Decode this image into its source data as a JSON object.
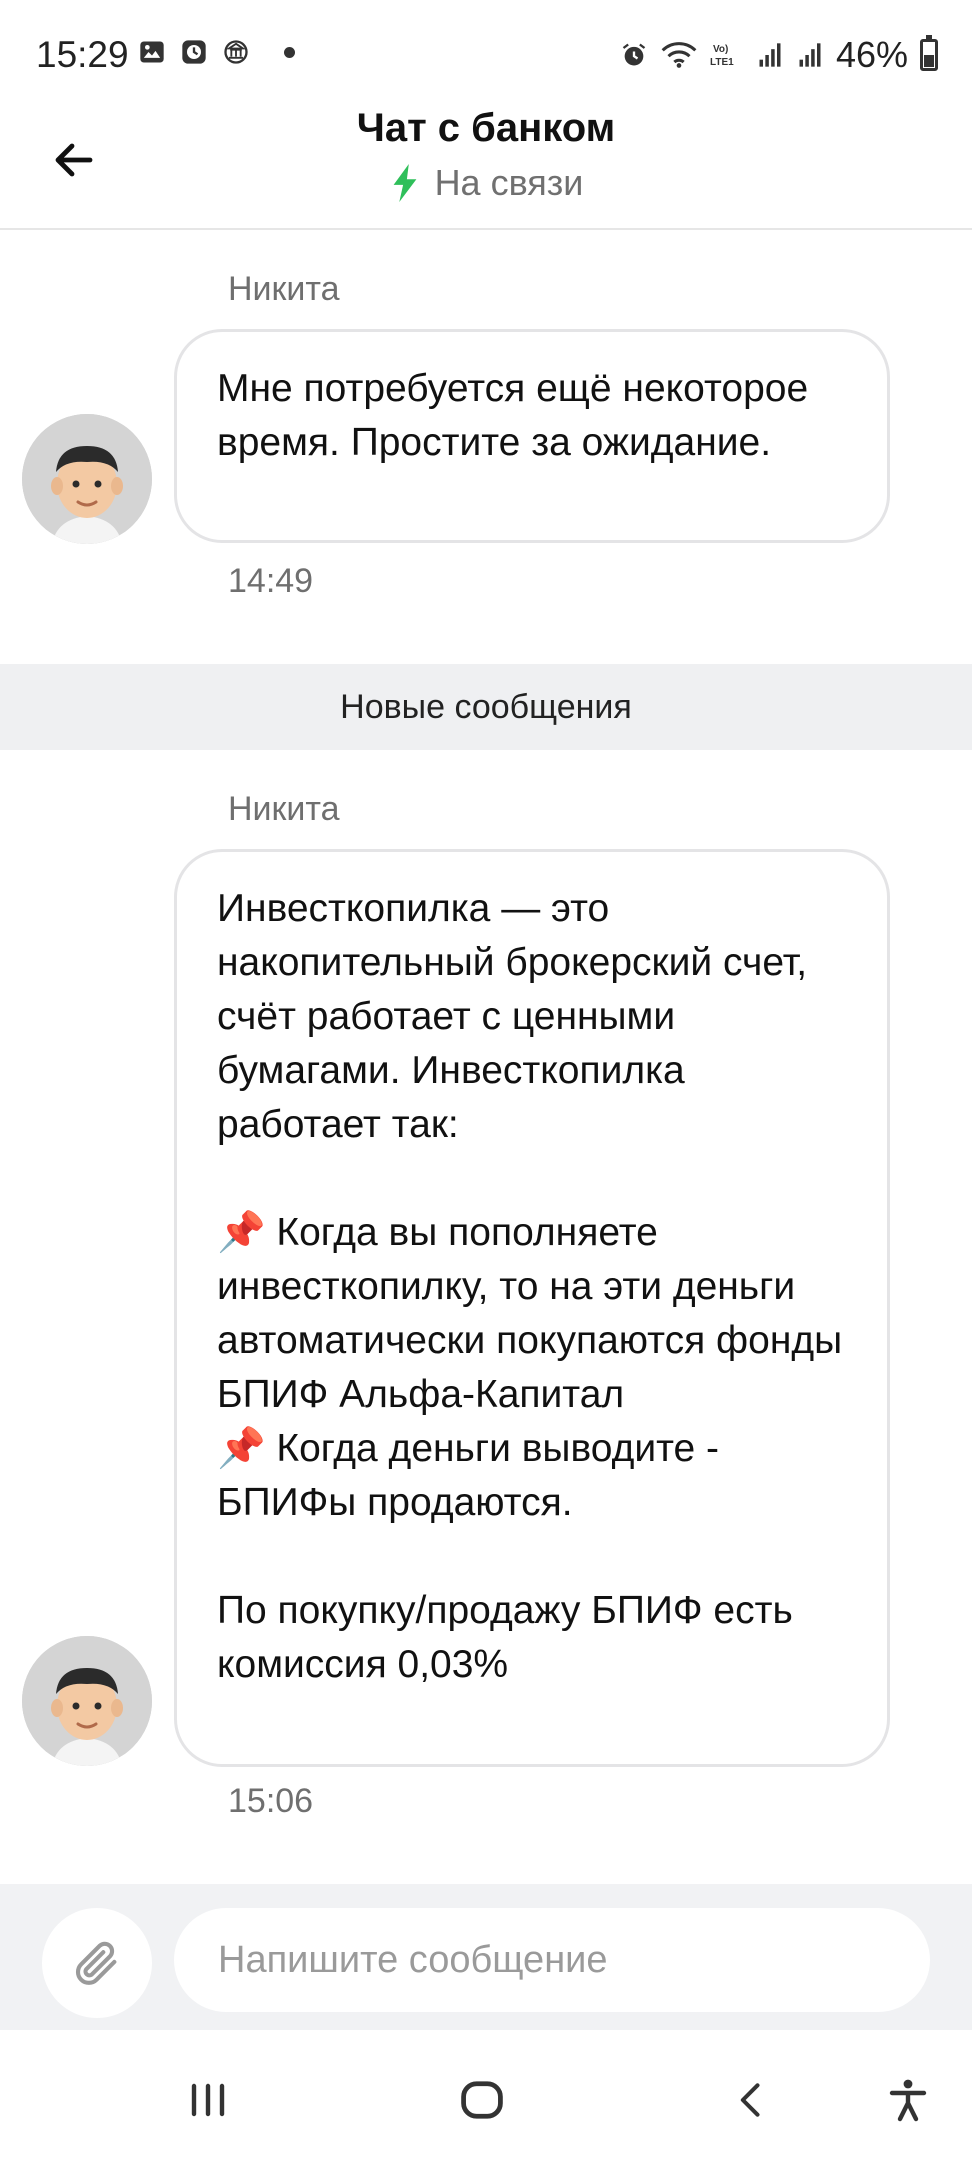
{
  "status_bar": {
    "time": "15:29",
    "battery": "46%",
    "icons": [
      "gallery-icon",
      "clock-icon",
      "bank-icon",
      "dot-icon",
      "alarm-icon",
      "wifi-icon",
      "volte-icon",
      "signal-icon",
      "signal-icon",
      "battery-icon"
    ]
  },
  "header": {
    "title": "Чат с банком",
    "status": "На связи",
    "status_color": "#2fbf5a",
    "back_icon": "arrow-left-icon"
  },
  "messages": [
    {
      "sender": "Никита",
      "text": "Мне потребуется ещё некоторое время. Простите за ожидание.",
      "time": "14:49"
    },
    {
      "sender": "Никита",
      "text": "Инвесткопилка — это накопительный брокерский счет, счёт работает с ценными бумагами. Инвесткопилка работает так:\n\n📌 Когда вы пополняете инвесткопилку, то на эти деньги автоматически покупаются фонды БПИФ Альфа-Капитал\n📌 Когда деньги выводите - БПИФы продаются.\n\nПо покупку/продажу БПИФ есть комиссия 0,03%",
      "time": "15:06"
    }
  ],
  "divider": {
    "label": "Новые сообщения"
  },
  "composer": {
    "placeholder": "Напишите сообщение",
    "value": "",
    "attach_icon": "paperclip-icon"
  },
  "navbar": {
    "buttons": [
      "recents-icon",
      "home-icon",
      "back-icon",
      "accessibility-icon"
    ]
  }
}
